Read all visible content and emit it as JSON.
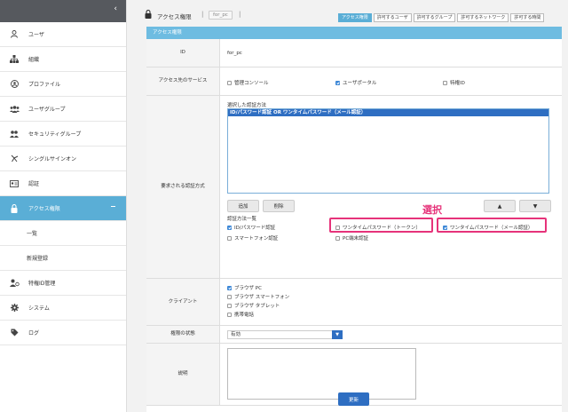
{
  "sidebar": {
    "collapse_glyph": "‹",
    "items": [
      {
        "label": "ユーザ",
        "icon": "user-icon"
      },
      {
        "label": "組織",
        "icon": "org-icon"
      },
      {
        "label": "プロファイル",
        "icon": "profile-icon"
      },
      {
        "label": "ユーザグループ",
        "icon": "user-group-icon"
      },
      {
        "label": "セキュリティグループ",
        "icon": "security-group-icon"
      },
      {
        "label": "シングルサインオン",
        "icon": "sso-icon"
      },
      {
        "label": "認証",
        "icon": "auth-icon"
      },
      {
        "label": "アクセス権限",
        "icon": "lock-icon",
        "active": true
      },
      {
        "label": "特権ID管理",
        "icon": "privileged-id-icon"
      },
      {
        "label": "システム",
        "icon": "gear-icon"
      },
      {
        "label": "ログ",
        "icon": "tag-icon"
      }
    ],
    "subitems": [
      "一覧",
      "新規登録"
    ]
  },
  "header": {
    "title": "アクセス権限",
    "separator": "|",
    "badge": "for_pc",
    "tabs": [
      "アクセス権限",
      "許可するユーザ",
      "許可するグループ",
      "許可するネットワーク",
      "許可する時間"
    ]
  },
  "panel": {
    "title": "アクセス権限",
    "rows": {
      "id": {
        "label": "ID",
        "value": "for_pc"
      },
      "services": {
        "label": "アクセス先のサービス",
        "options": [
          {
            "label": "管理コンソール",
            "checked": false
          },
          {
            "label": "ユーザポータル",
            "checked": true
          },
          {
            "label": "特権ID",
            "checked": false
          }
        ]
      },
      "auth": {
        "label": "要求される認証方式",
        "selected_caption": "選択した認証方法",
        "selected_item": "ID/パスワード認証 OR ワンタイムパスワード（メール認証）",
        "add_label": "追加",
        "delete_label": "削除",
        "up_glyph": "▲",
        "down_glyph": "▼",
        "methods_caption": "認証方法一覧",
        "methods": [
          {
            "label": "ID/パスワード認証",
            "checked": true
          },
          {
            "label": "ワンタイムパスワード（トークン）",
            "checked": false
          },
          {
            "label": "ワンタイムパスワード（メール認証）",
            "checked": true
          },
          {
            "label": "スマートフォン認証",
            "checked": false
          },
          {
            "label": "PC端末認証",
            "checked": false
          }
        ],
        "annotation": "選択"
      },
      "client": {
        "label": "クライアント",
        "options": [
          {
            "label": "ブラウザ PC",
            "checked": true
          },
          {
            "label": "ブラウザ スマートフォン",
            "checked": false
          },
          {
            "label": "ブラウザ タブレット",
            "checked": false
          },
          {
            "label": "携帯電話",
            "checked": false
          }
        ]
      },
      "state": {
        "label": "権限の状態",
        "value": "有効",
        "arrow": "▼"
      },
      "desc": {
        "label": "説明"
      }
    },
    "update_label": "更新"
  },
  "colors": {
    "accent": "#5aaed6",
    "primary_button": "#2e6ec2",
    "highlight": "#e6337a"
  }
}
